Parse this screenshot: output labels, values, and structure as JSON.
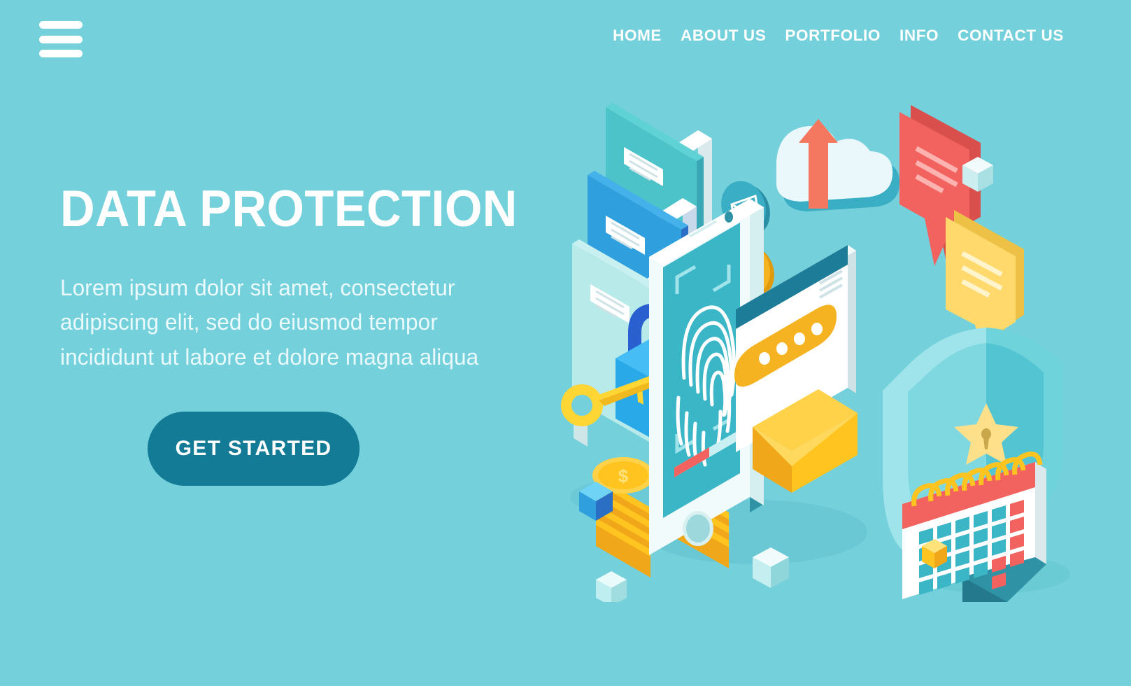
{
  "page": {
    "background_color": "#74d0da",
    "accent_color": "#137b95"
  },
  "nav": {
    "menu_icon": "hamburger-menu-icon",
    "links": [
      {
        "label": "HOME"
      },
      {
        "label": "ABOUT US"
      },
      {
        "label": "PORTFOLIO"
      },
      {
        "label": "INFO"
      },
      {
        "label": "CONTACT US"
      }
    ]
  },
  "hero": {
    "headline": "DATA PROTECTION",
    "paragraph": "Lorem ipsum dolor sit amet, consectetur adipiscing elit, sed do eiusmod tempor incididunt ut labore et dolore magna aliqua",
    "cta_label": "GET STARTED"
  },
  "illustration": {
    "description": "Isometric data protection scene",
    "elements": [
      {
        "name": "folder-stack",
        "colors": [
          "#4cc3c9",
          "#2f9fdd",
          "#b8eaea"
        ]
      },
      {
        "name": "padlock",
        "colors": [
          "#29a9e8",
          "#2a5fd0"
        ]
      },
      {
        "name": "key",
        "color": "#ffd633"
      },
      {
        "name": "coin-stacks",
        "color": "#ffc41f",
        "symbol": "$"
      },
      {
        "name": "mail-badge",
        "color": "#3aaec4"
      },
      {
        "name": "mobile-badge",
        "color": "#f5b321"
      },
      {
        "name": "heart-badge",
        "color": "#3aaec4"
      },
      {
        "name": "dollar-badge",
        "color": "#f2625f"
      },
      {
        "name": "cloud-upload",
        "colors": [
          "#eaf8fb",
          "#f4775f"
        ]
      },
      {
        "name": "chat-bubble-red",
        "color": "#f2625f"
      },
      {
        "name": "chat-bubble-yellow",
        "color": "#ffd96b"
      },
      {
        "name": "smartphone-fingerprint-scanner",
        "colors": [
          "#ffffff",
          "#3bb6c6"
        ]
      },
      {
        "name": "password-window",
        "colors": [
          "#ffffff",
          "#f5b321"
        ],
        "dots": 4
      },
      {
        "name": "envelope",
        "color": "#ffc41f"
      },
      {
        "name": "shield-star",
        "colors": [
          "#6fd3dc",
          "#ffe08a"
        ]
      },
      {
        "name": "desk-calendar",
        "colors": [
          "#f2625f",
          "#ffffff",
          "#ffc41f"
        ]
      },
      {
        "name": "floating-cube-blue",
        "color": "#2f9fdd"
      },
      {
        "name": "floating-cube-mint",
        "color": "#bfeef0"
      },
      {
        "name": "floating-cube-white",
        "color": "#e8fbfd"
      },
      {
        "name": "floating-cube-yellow",
        "color": "#ffc41f"
      }
    ]
  }
}
